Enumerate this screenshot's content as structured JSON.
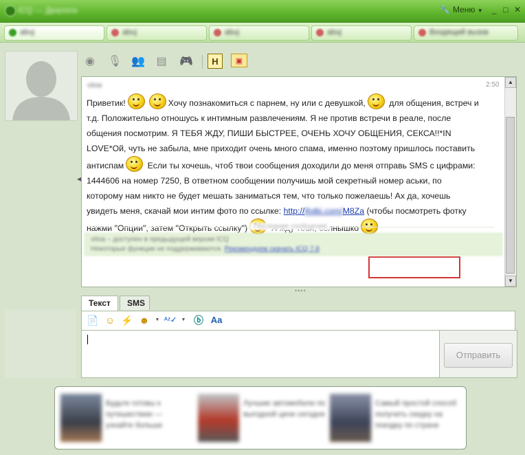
{
  "window": {
    "title": "ICQ — Диалоги",
    "menu_label": "Меню",
    "menu_arrow": "▼",
    "minimize": "_",
    "maximize": "□",
    "close": "✕"
  },
  "contact_tabs": [
    {
      "label": "abuj"
    },
    {
      "label": "abuj"
    },
    {
      "label": "abuj"
    },
    {
      "label": "abuj"
    },
    {
      "label": "Входящий вызов"
    }
  ],
  "toolbar": {
    "icons": [
      "webcam-icon",
      "microphone-icon",
      "contacts-icon",
      "files-icon",
      "games-icon",
      "history-icon",
      "profile-card-icon"
    ],
    "history_label": "H"
  },
  "message": {
    "sender": "vitoa",
    "time": "2:50",
    "lines": [
      {
        "before": "Приветик!",
        "after": "Хочу познакомиться с парнем, ну или с девушкой,",
        "tail": "для общения, встреч и"
      },
      {
        "text": "т.д. Положительно отношусь к интимным развлечениям. Я не против встречи в реале, после"
      },
      {
        "text": "общения посмотрим. Я ТЕБЯ ЖДУ, ПИШИ БЫСТРЕЕ, ОЧЕНЬ ХОЧУ ОБЩЕНИЯ, СЕКСА!!*IN"
      },
      {
        "text": "LOVE*Ой, чуть не забыла, мне приходит очень много спама, именно поэтому пришлось поставить"
      },
      {
        "before": "антиспам",
        "after": "Если ты хочешь, чтоб твои сообщения доходили до меня отправь SMS  с цифрами:"
      },
      {
        "text": "1444606 на номер 7250,  В ответном сообщении получишь мой секретный номер аськи, по"
      },
      {
        "text": "которому нам никто не будет мешать заниматься тем, что только пожелаешь! Ах да, хочешь"
      },
      {
        "before": "увидеть меня, скачай мои интим фото по ссылке:",
        "link_prefix": "http://",
        "link_hidden": "ifotki.com/",
        "link_suffix": "M8Za",
        "after": "(чтобы посмотреть фотку"
      },
      {
        "before": "нажми \"Опции\", затем \"Открыть ссылку\")",
        "after": "Я жду тебя, солнышко"
      }
    ]
  },
  "separator_label": "Последние сообщения",
  "system_note": {
    "line1": "vitoa – доступен в предыдущей версии ICQ",
    "line2": "Некоторые функции не поддерживаются.",
    "link": "Рекомендуем скачать ICQ 7.8"
  },
  "grip": "••••",
  "input": {
    "tabs": [
      "Текст",
      "SMS"
    ],
    "tools": [
      "attach-file-icon",
      "smiley-icon",
      "wink-icon",
      "emoticon-pack-icon",
      "spellcheck-icon",
      "buzz-icon",
      "font-icon"
    ],
    "send_label": "Отправить",
    "value": ""
  },
  "ads": [
    {
      "text": "Будьте готовы к путешествию — узнайте больше"
    },
    {
      "text": "Лучшие автомобили по выгодной цене сегодня"
    },
    {
      "text": "Самый простой способ получить скидку на поездку по стране"
    }
  ]
}
